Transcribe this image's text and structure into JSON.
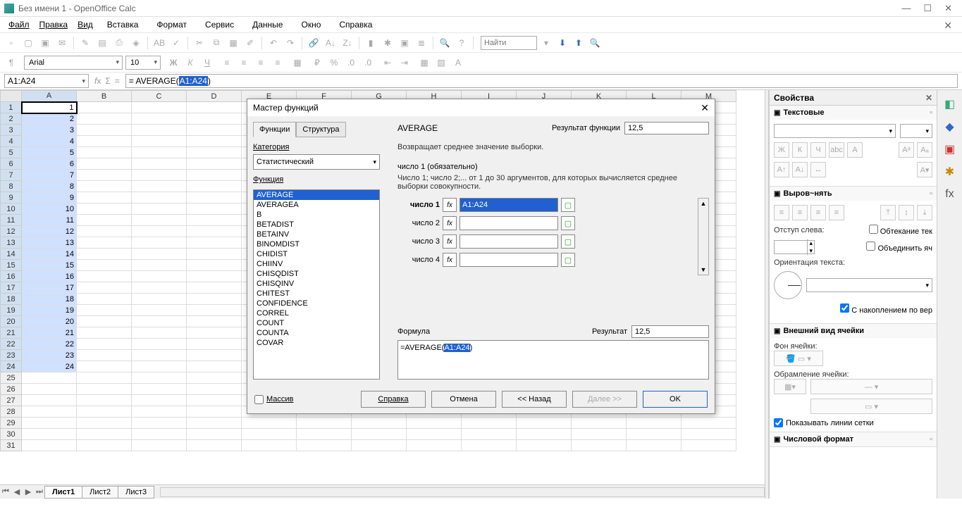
{
  "window": {
    "title": "Без имени 1 - OpenOffice Calc"
  },
  "menu": {
    "file": "Файл",
    "edit": "Правка",
    "view": "Вид",
    "insert": "Вставка",
    "format": "Формат",
    "tools": "Сервис",
    "data": "Данные",
    "window": "Окно",
    "help": "Справка"
  },
  "find": {
    "placeholder": "Найти"
  },
  "format_bar": {
    "font": "Arial",
    "size": "10"
  },
  "formula_bar": {
    "name_box": "A1:A24",
    "input_prefix": "= AVERAGE(",
    "input_sel": "A1:A24",
    "input_suffix": ")"
  },
  "columns": [
    "A",
    "B",
    "C",
    "D",
    "E",
    "F",
    "G",
    "H",
    "I",
    "J",
    "K",
    "L",
    "M"
  ],
  "rows": 31,
  "selected_col": "A",
  "values_col_a": [
    1,
    2,
    3,
    4,
    5,
    6,
    7,
    8,
    9,
    10,
    11,
    12,
    13,
    14,
    15,
    16,
    17,
    18,
    19,
    20,
    21,
    22,
    23,
    24
  ],
  "sheet_tabs": {
    "active": "Лист1",
    "others": [
      "Лист2",
      "Лист3"
    ]
  },
  "sidebar": {
    "title": "Свойства",
    "text_section": "Текстовые",
    "align_section": "Выров~нять",
    "indent_label": "Отступ слева:",
    "wrap_label": "Обтекание тек",
    "merge_label": "Объединить яч",
    "orientation_label": "Ориентация текста:",
    "stack_label": "С накоплением по вер",
    "cell_section": "Внешний вид ячейки",
    "bg_label": "Фон ячейки:",
    "border_label": "Обрамление ячейки:",
    "grid_checkbox": "Показывать линии сетки",
    "number_section": "Числовой формат"
  },
  "dialog": {
    "title": "Мастер функций",
    "tab_functions": "Функции",
    "tab_structure": "Структура",
    "category_label": "Категория",
    "category_value": "Статистический",
    "function_label": "Функция",
    "functions": [
      "AVERAGE",
      "AVERAGEA",
      "B",
      "BETADIST",
      "BETAINV",
      "BINOMDIST",
      "CHIDIST",
      "CHIINV",
      "CHISQDIST",
      "CHISQINV",
      "CHITEST",
      "CONFIDENCE",
      "CORREL",
      "COUNT",
      "COUNTA",
      "COVAR"
    ],
    "function_selected": "AVERAGE",
    "fn_name": "AVERAGE",
    "result_label": "Результат функции",
    "result_value": "12,5",
    "description": "Возвращает среднее значение выборки.",
    "required_label": "число 1 (обязательно)",
    "hint": "Число 1; число 2;... от 1 до 30 аргументов, для которых вычисляется среднее выборки совокупности.",
    "args": [
      {
        "label": "число 1",
        "bold": true,
        "value": "A1:A24",
        "active": true
      },
      {
        "label": "число 2",
        "bold": false,
        "value": "",
        "active": false
      },
      {
        "label": "число 3",
        "bold": false,
        "value": "",
        "active": false
      },
      {
        "label": "число 4",
        "bold": false,
        "value": "",
        "active": false
      }
    ],
    "formula_label": "Формула",
    "result2_label": "Результат",
    "result2_value": "12,5",
    "formula_prefix": "=AVERAGE(",
    "formula_sel": "A1:A24",
    "formula_suffix": ")",
    "array_label": "Массив",
    "btn_help": "Справка",
    "btn_cancel": "Отмена",
    "btn_back": "<< Назад",
    "btn_next": "Далее >>",
    "btn_ok": "OK"
  }
}
